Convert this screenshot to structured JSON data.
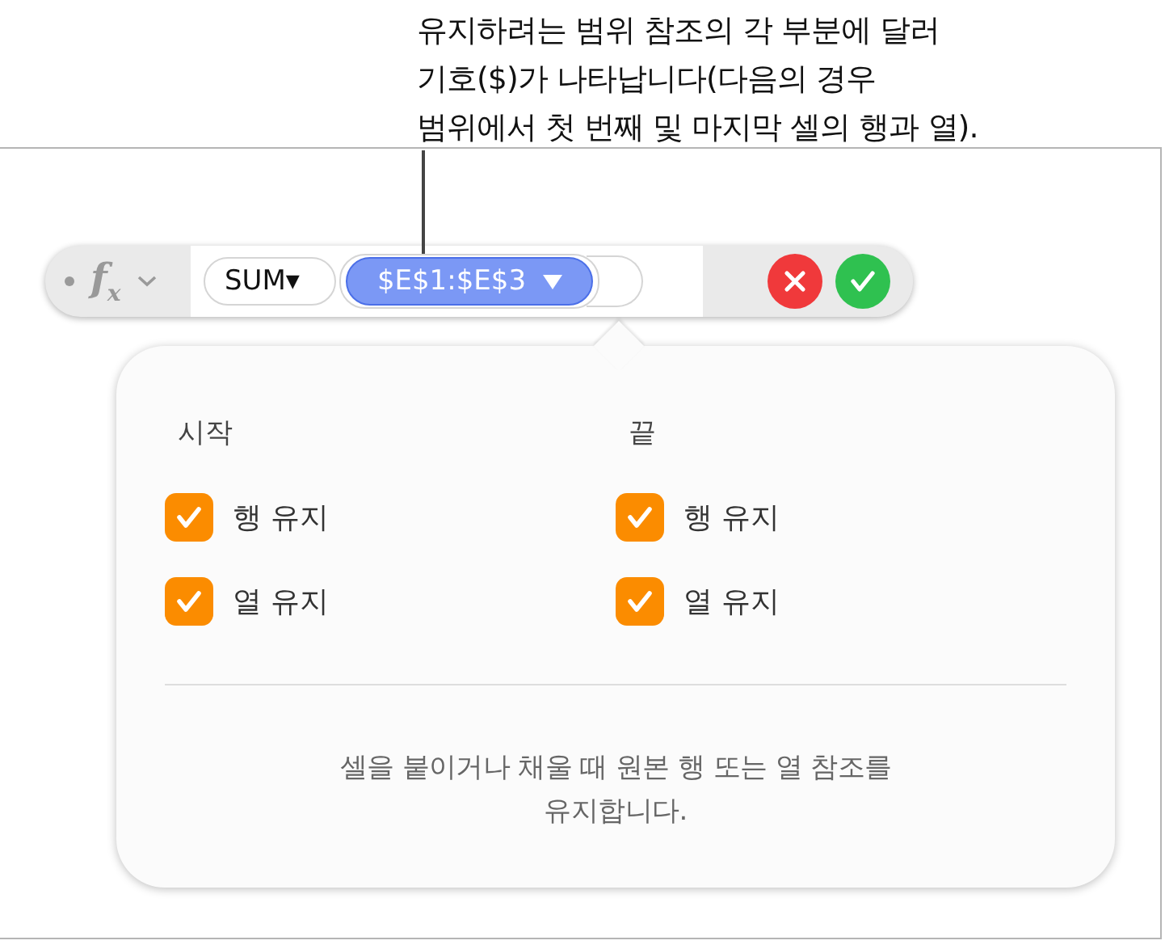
{
  "callout": {
    "lines": [
      "유지하려는 범위 참조의 각 부분에 달러",
      "기호($)가 나타납니다(다음의 경우",
      "범위에서 첫 번째 및 마지막 셀의 행과 열)."
    ]
  },
  "formula_bar": {
    "label": "f$_{x}$",
    "function": "SUM▾",
    "token": "$E$1:$E$3"
  },
  "popover": {
    "columns": [
      {
        "heading": "시작",
        "options": [
          {
            "label": "행 유지",
            "checked": true
          },
          {
            "label": "열 유지",
            "checked": true
          }
        ]
      },
      {
        "heading": "끝",
        "options": [
          {
            "label": "행 유지",
            "checked": true
          },
          {
            "label": "열 유지",
            "checked": true
          }
        ]
      }
    ],
    "description": "셀을 붙이거나 채울 때 원본 행 또는 열 참조를\n유지합니다."
  }
}
